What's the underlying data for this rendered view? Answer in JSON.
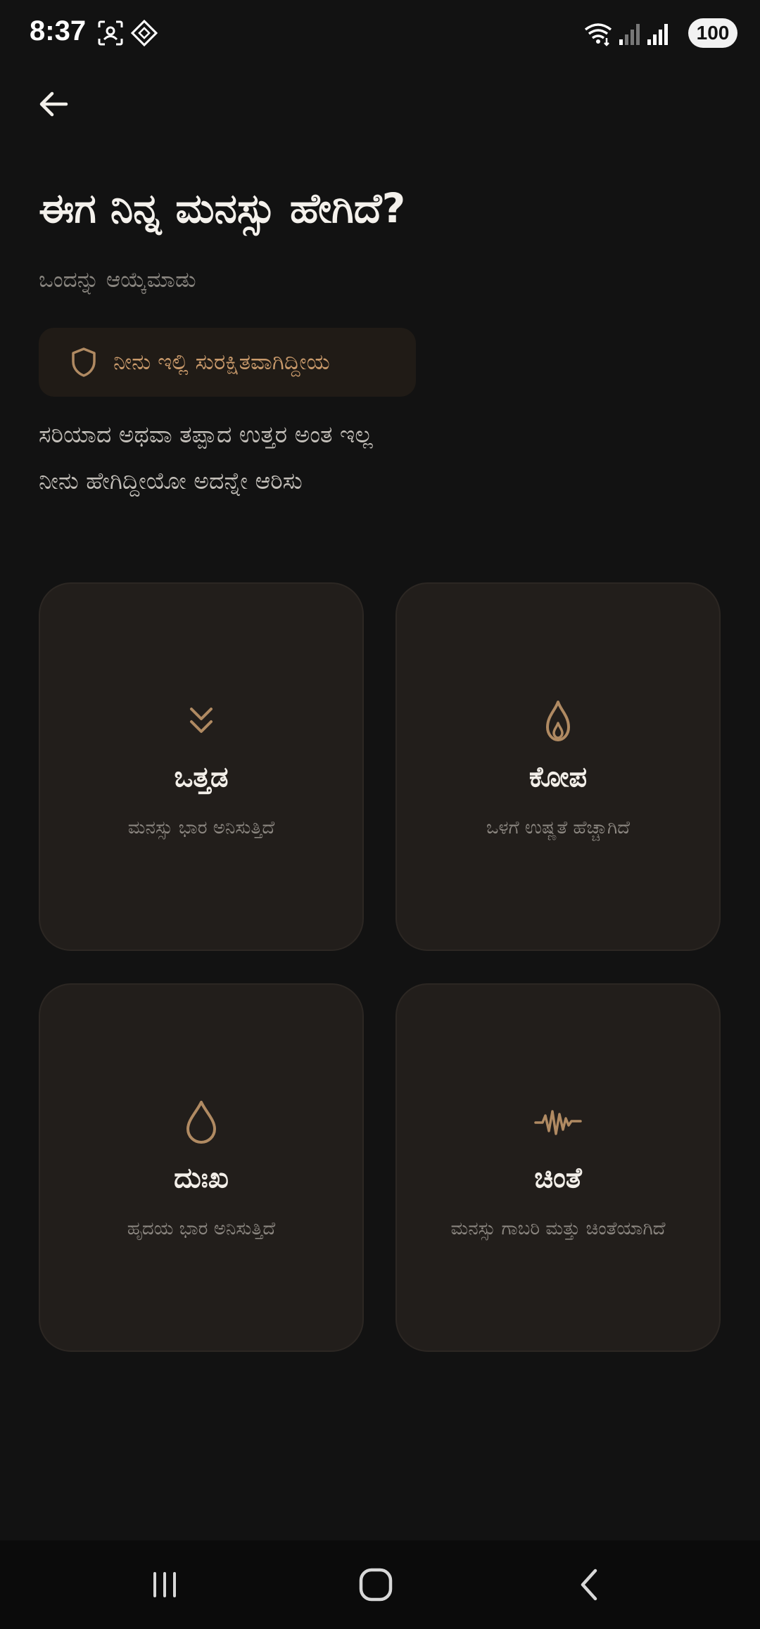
{
  "status_bar": {
    "time": "8:37",
    "battery": "100",
    "icons": [
      "screenshot-icon",
      "assistant-icon",
      "wifi-icon",
      "signal-icon",
      "signal-icon",
      "battery-icon"
    ]
  },
  "header": {
    "back_icon": "arrow-left-icon"
  },
  "main": {
    "title": "ಈಗ ನಿನ್ನ ಮನಸ್ಸು ಹೇಗಿದೆ?",
    "subtitle": "ಒಂದನ್ನು ಆಯ್ಕೆಮಾಡು",
    "safe_badge": {
      "icon": "shield-icon",
      "text": "ನೀನು ಇಲ್ಲಿ ಸುರಕ್ಷಿತವಾಗಿದ್ದೀಯ"
    },
    "reassurance": [
      "ಸರಿಯಾದ ಅಥವಾ ತಪ್ಪಾದ ಉತ್ತರ ಅಂತ ಇಲ್ಲ",
      "ನೀನು ಹೇಗಿದ್ದೀಯೋ ಅದನ್ನೇ ಆರಿಸು"
    ],
    "moods": [
      {
        "icon": "chevrons-down-icon",
        "title": "ಒತ್ತಡ",
        "description": "ಮನಸ್ಸು ಭಾರ ಅನಿಸುತ್ತಿದೆ"
      },
      {
        "icon": "flame-icon",
        "title": "ಕೋಪ",
        "description": "ಒಳಗೆ ಉಷ್ಣತೆ ಹೆಚ್ಚಾಗಿದೆ"
      },
      {
        "icon": "droplet-icon",
        "title": "ದುಃಖ",
        "description": "ಹೃದಯ ಭಾರ ಅನಿಸುತ್ತಿದೆ"
      },
      {
        "icon": "waveform-icon",
        "title": "ಚಿಂತೆ",
        "description": "ಮನಸ್ಸು ಗಾಬರಿ ಮತ್ತು ಚಿಂತೆಯಾಗಿದೆ"
      }
    ]
  },
  "nav_bar": {
    "buttons": [
      "recent-apps-icon",
      "home-icon",
      "back-icon"
    ]
  },
  "colors": {
    "background": "#121212",
    "card_background": "#221e1b",
    "accent": "#b08a62",
    "badge_text": "#c99a6b"
  }
}
